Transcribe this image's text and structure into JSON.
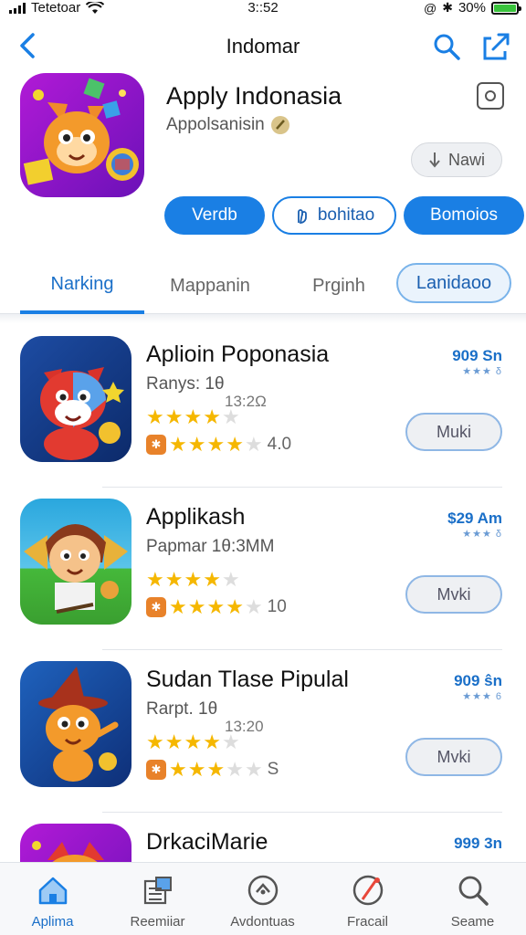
{
  "status": {
    "carrier": "Tetetoar",
    "time": "3::52",
    "battery": "30%"
  },
  "nav": {
    "title": "Indomar"
  },
  "hero": {
    "app_name": "Apply Indonasia",
    "developer": "Appolsanisin",
    "install_label": "Nawi",
    "buttons": [
      "Verdb",
      "bohitao",
      "Bomoios"
    ]
  },
  "tabs": [
    "Narking",
    "Mappanin",
    "Prginh",
    "Lanidaoo"
  ],
  "apps": [
    {
      "title": "Aplioin Poponasia",
      "subtitle": "Ranys: 1θ",
      "time": "13:2Ω",
      "rating": 4,
      "count": "4.0",
      "price": "909 Sn",
      "price_sub": "★★★ δ",
      "get_label": "Muki",
      "colors": [
        "#1a3f92",
        "#0c2a6a"
      ]
    },
    {
      "title": "Applikash",
      "subtitle": "Papmar 1θ:3ΜΜ",
      "time": "",
      "rating": 4,
      "count": "10",
      "price": "$29 Am",
      "price_sub": "★★★ δ",
      "get_label": "Mvki",
      "colors": [
        "#2aa7de",
        "#45b83a"
      ]
    },
    {
      "title": "Sudan Tlase Pipulal",
      "subtitle": "Rarpt. 1θ",
      "time": "13:20",
      "rating": 4,
      "count": "S",
      "price": "909 ŝn",
      "price_sub": "★★★ 6",
      "get_label": "Mvki",
      "colors": [
        "#1a5bb8",
        "#0e2f78"
      ]
    },
    {
      "title": "DrkaciMarie",
      "subtitle": "",
      "time": "",
      "rating": 0,
      "count": "",
      "price": "999 3n",
      "price_sub": "",
      "get_label": "",
      "colors": [
        "#b11ad6",
        "#ff3c5a"
      ]
    }
  ],
  "tabbar": [
    {
      "label": "Aplima",
      "icon": "home-icon",
      "active": true
    },
    {
      "label": "Reemiiar",
      "icon": "calendar-icon",
      "active": false
    },
    {
      "label": "Avdontuas",
      "icon": "compass-icon",
      "active": false
    },
    {
      "label": "Fracail",
      "icon": "pen-icon",
      "active": false
    },
    {
      "label": "Seame",
      "icon": "search-icon",
      "active": false
    }
  ],
  "colors": {
    "accent": "#1a7fe4",
    "star": "#f5b700",
    "badge": "#e8822a"
  }
}
